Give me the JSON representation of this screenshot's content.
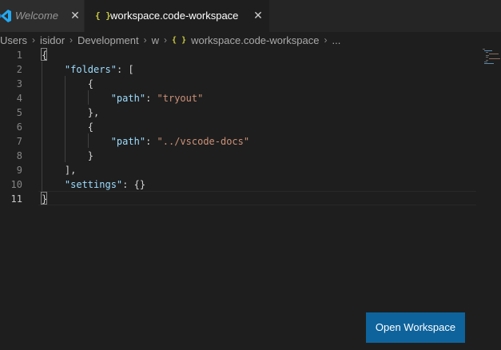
{
  "tabs": [
    {
      "label": "Welcome",
      "icon": "vscode-logo-icon",
      "active": false,
      "italic": true
    },
    {
      "label": "workspace.code-workspace",
      "icon": "json-braces-icon",
      "icon_glyph": "{ }",
      "active": true
    }
  ],
  "close_glyph": "✕",
  "breadcrumb": {
    "items": [
      "Users",
      "isidor",
      "Development",
      "w",
      "workspace.code-workspace",
      "..."
    ],
    "separator": "›",
    "file_icon_glyph": "{ }"
  },
  "editor": {
    "current_line": 11,
    "line_numbers": [
      "1",
      "2",
      "3",
      "4",
      "5",
      "6",
      "7",
      "8",
      "9",
      "10",
      "11"
    ],
    "lines": [
      [
        {
          "t": "{",
          "c": "p"
        }
      ],
      [
        {
          "t": "    ",
          "c": "p"
        },
        {
          "t": "\"folders\"",
          "c": "k"
        },
        {
          "t": ": [",
          "c": "p"
        }
      ],
      [
        {
          "t": "        {",
          "c": "p"
        }
      ],
      [
        {
          "t": "            ",
          "c": "p"
        },
        {
          "t": "\"path\"",
          "c": "k"
        },
        {
          "t": ": ",
          "c": "p"
        },
        {
          "t": "\"tryout\"",
          "c": "s"
        }
      ],
      [
        {
          "t": "        },",
          "c": "p"
        }
      ],
      [
        {
          "t": "        {",
          "c": "p"
        }
      ],
      [
        {
          "t": "            ",
          "c": "p"
        },
        {
          "t": "\"path\"",
          "c": "k"
        },
        {
          "t": ": ",
          "c": "p"
        },
        {
          "t": "\"../vscode-docs\"",
          "c": "s"
        }
      ],
      [
        {
          "t": "        }",
          "c": "p"
        }
      ],
      [
        {
          "t": "    ],",
          "c": "p"
        }
      ],
      [
        {
          "t": "    ",
          "c": "p"
        },
        {
          "t": "\"settings\"",
          "c": "k"
        },
        {
          "t": ": {}",
          "c": "p"
        }
      ],
      [
        {
          "t": "}",
          "c": "p"
        }
      ]
    ]
  },
  "open_workspace_button": {
    "label": "Open Workspace"
  },
  "colors": {
    "accent_button": "#0e639c",
    "json_key": "#9cdcfe",
    "json_string": "#ce9178",
    "json_icon": "#cbcb41",
    "vscode_logo": "#23a9f2"
  }
}
